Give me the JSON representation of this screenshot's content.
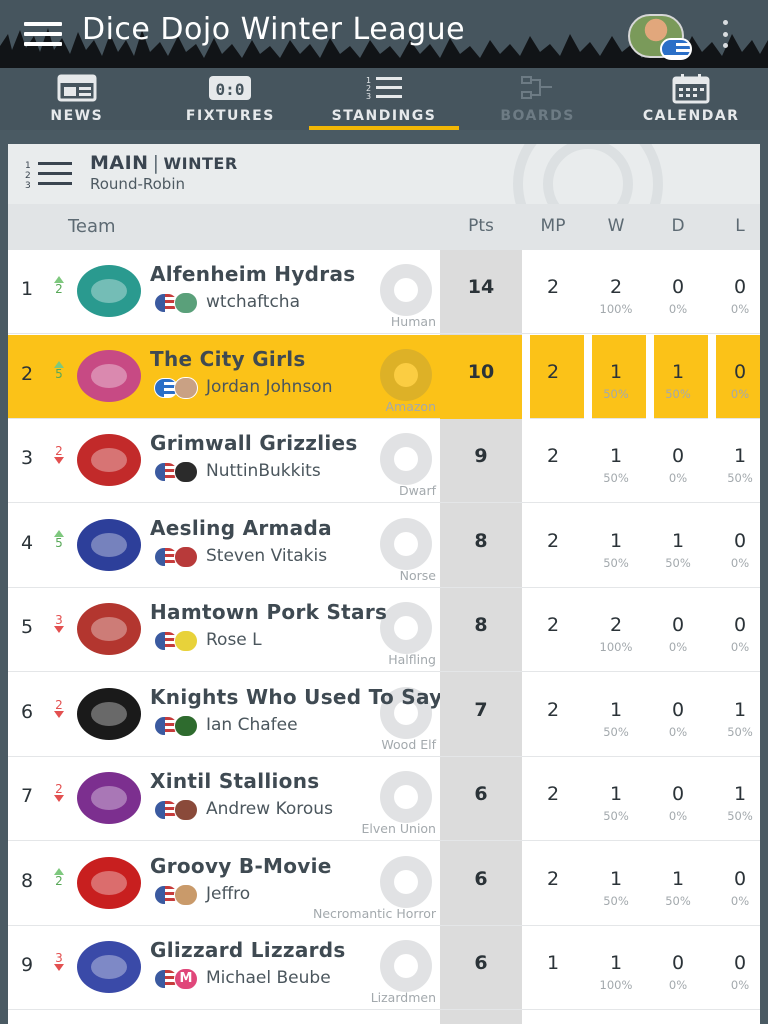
{
  "app": {
    "title": "Dice Dojo Winter League"
  },
  "tabs": [
    {
      "label": "NEWS",
      "icon": "news-icon",
      "state": "normal"
    },
    {
      "label": "FIXTURES",
      "icon": "fixtures-icon",
      "state": "normal"
    },
    {
      "label": "STANDINGS",
      "icon": "standings-icon",
      "state": "active"
    },
    {
      "label": "BOARDS",
      "icon": "boards-icon",
      "state": "disabled"
    },
    {
      "label": "CALENDAR",
      "icon": "calendar-icon",
      "state": "normal"
    }
  ],
  "division": {
    "name": "MAIN",
    "separator": "|",
    "season": "WINTER",
    "format": "Round-Robin"
  },
  "columns": {
    "team": "Team",
    "pts": "Pts",
    "mp": "MP",
    "w": "W",
    "d": "D",
    "l": "L"
  },
  "colors": {
    "header_bg": "#46555e",
    "accent": "#f2b705",
    "highlight_row": "#fbc218",
    "up": "#7ec87e",
    "down": "#e35050"
  },
  "standings": [
    {
      "rank": "1",
      "move_dir": "up",
      "move": "2",
      "team": "Alfenheim Hydras",
      "coach": "wtchaftcha",
      "coach_flag": "us",
      "race": "Human",
      "pts": "14",
      "mp": "2",
      "w": "2",
      "w_pct": "100%",
      "d": "0",
      "d_pct": "0%",
      "l": "0",
      "l_pct": "0%",
      "logo_color": "#2a9a8f",
      "pic_color": "#5aa07a"
    },
    {
      "rank": "2",
      "move_dir": "up",
      "move": "5",
      "team": "The City Girls",
      "coach": "Jordan Johnson",
      "coach_flag": "gr",
      "race": "Amazon",
      "pts": "10",
      "mp": "2",
      "w": "1",
      "w_pct": "50%",
      "d": "1",
      "d_pct": "50%",
      "l": "0",
      "l_pct": "0%",
      "logo_color": "#c74a84",
      "pic_color": "#c9a184",
      "highlight": true
    },
    {
      "rank": "3",
      "move_dir": "down",
      "move": "2",
      "team": "Grimwall Grizzlies",
      "coach": "NuttinBukkits",
      "coach_flag": "us",
      "race": "Dwarf",
      "pts": "9",
      "mp": "2",
      "w": "1",
      "w_pct": "50%",
      "d": "0",
      "d_pct": "0%",
      "l": "1",
      "l_pct": "50%",
      "logo_color": "#c22a2a",
      "pic_color": "#2b2b2b"
    },
    {
      "rank": "4",
      "move_dir": "up",
      "move": "5",
      "team": "Aesling Armada",
      "coach": "Steven Vitakis",
      "coach_flag": "us",
      "race": "Norse",
      "pts": "8",
      "mp": "2",
      "w": "1",
      "w_pct": "50%",
      "d": "1",
      "d_pct": "50%",
      "l": "0",
      "l_pct": "0%",
      "logo_color": "#2d3f9a",
      "pic_color": "#b83a3a"
    },
    {
      "rank": "5",
      "move_dir": "down",
      "move": "3",
      "team": "Hamtown Pork Stars",
      "coach": "Rose L",
      "coach_flag": "us",
      "race": "Halfling",
      "pts": "8",
      "mp": "2",
      "w": "2",
      "w_pct": "100%",
      "d": "0",
      "d_pct": "0%",
      "l": "0",
      "l_pct": "0%",
      "logo_color": "#b3362f",
      "pic_color": "#e8d23a"
    },
    {
      "rank": "6",
      "move_dir": "down",
      "move": "2",
      "team": "Knights Who Used To Say Ni",
      "coach": "Ian Chafee",
      "coach_flag": "us",
      "race": "Wood Elf",
      "pts": "7",
      "mp": "2",
      "w": "1",
      "w_pct": "50%",
      "d": "0",
      "d_pct": "0%",
      "l": "1",
      "l_pct": "50%",
      "logo_color": "#1a1a1a",
      "pic_color": "#2e6b2e"
    },
    {
      "rank": "7",
      "move_dir": "down",
      "move": "2",
      "team": "Xintil Stallions",
      "coach": "Andrew Korous",
      "coach_flag": "us",
      "race": "Elven Union",
      "pts": "6",
      "mp": "2",
      "w": "1",
      "w_pct": "50%",
      "d": "0",
      "d_pct": "0%",
      "l": "1",
      "l_pct": "50%",
      "logo_color": "#7c2f8f",
      "pic_color": "#8a4a3a"
    },
    {
      "rank": "8",
      "move_dir": "up",
      "move": "2",
      "team": "Groovy B-Movie",
      "coach": "Jeffro",
      "coach_flag": "us",
      "race": "Necromantic Horror",
      "pts": "6",
      "mp": "2",
      "w": "1",
      "w_pct": "50%",
      "d": "1",
      "d_pct": "50%",
      "l": "0",
      "l_pct": "0%",
      "logo_color": "#c81f1f",
      "pic_color": "#c99a6a"
    },
    {
      "rank": "9",
      "move_dir": "down",
      "move": "3",
      "team": "Glizzard Lizzards",
      "coach": "Michael Beube",
      "coach_flag": "us",
      "race": "Lizardmen",
      "pts": "6",
      "mp": "1",
      "w": "1",
      "w_pct": "100%",
      "d": "0",
      "d_pct": "0%",
      "l": "0",
      "l_pct": "0%",
      "logo_color": "#3a4aa8",
      "pic_color": "#e0477a",
      "pic_letter": "M"
    }
  ]
}
